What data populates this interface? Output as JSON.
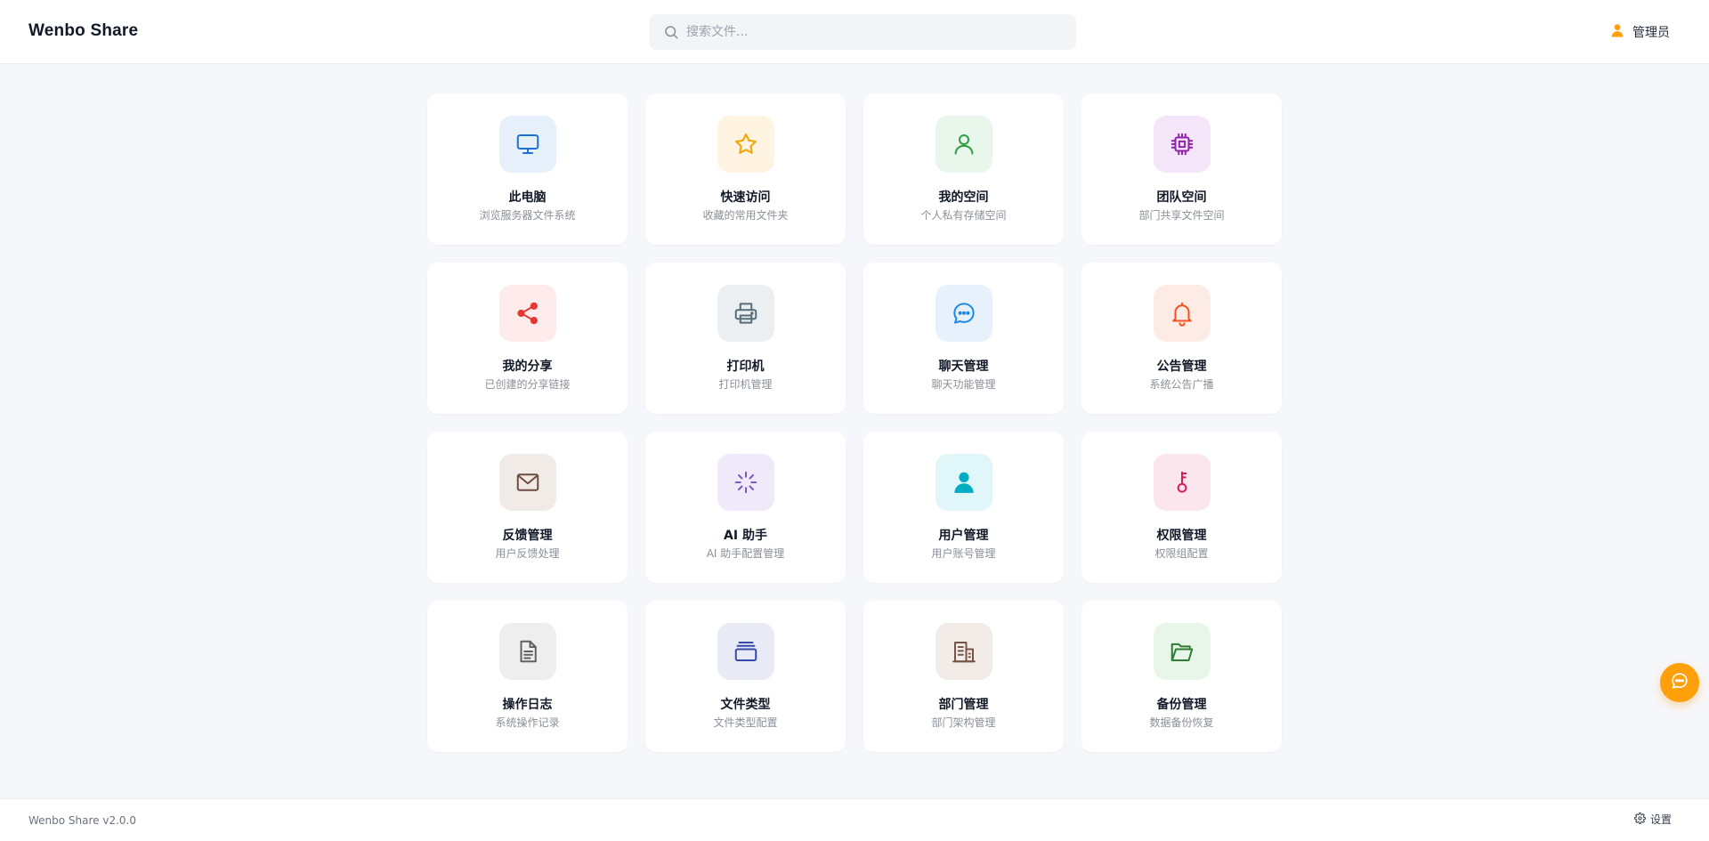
{
  "header": {
    "brand": "Wenbo Share",
    "search_placeholder": "搜索文件...",
    "user_label": "管理员",
    "accent_color": "#ff9f0a"
  },
  "cards": [
    {
      "name": "this-pc",
      "title": "此电脑",
      "desc": "浏览服务器文件系统",
      "icon": "monitor-icon",
      "color": "#1e6fd9",
      "bg": "#e6f0fb"
    },
    {
      "name": "quick-access",
      "title": "快速访问",
      "desc": "收藏的常用文件夹",
      "icon": "star-icon",
      "color": "#f5a300",
      "bg": "#fff4e2"
    },
    {
      "name": "my-space",
      "title": "我的空间",
      "desc": "个人私有存储空间",
      "icon": "user-outline-icon",
      "color": "#2e9e44",
      "bg": "#e9f6ec"
    },
    {
      "name": "team-space",
      "title": "团队空间",
      "desc": "部门共享文件空间",
      "icon": "chip-icon",
      "color": "#8e24aa",
      "bg": "#f4e6f8"
    },
    {
      "name": "my-share",
      "title": "我的分享",
      "desc": "已创建的分享链接",
      "icon": "share-icon",
      "color": "#e53935",
      "bg": "#fdeceb"
    },
    {
      "name": "printer",
      "title": "打印机",
      "desc": "打印机管理",
      "icon": "printer-icon",
      "color": "#546e7a",
      "bg": "#eceff1"
    },
    {
      "name": "chat-management",
      "title": "聊天管理",
      "desc": "聊天功能管理",
      "icon": "chat-icon",
      "color": "#1e88e5",
      "bg": "#e6f1fc"
    },
    {
      "name": "announcement-management",
      "title": "公告管理",
      "desc": "系统公告广播",
      "icon": "bell-icon",
      "color": "#f4511e",
      "bg": "#fdece5"
    },
    {
      "name": "feedback-management",
      "title": "反馈管理",
      "desc": "用户反馈处理",
      "icon": "mail-icon",
      "color": "#6d4c41",
      "bg": "#f1ebe8"
    },
    {
      "name": "ai-assistant",
      "title": "AI 助手",
      "desc": "AI 助手配置管理",
      "icon": "sparkle-icon",
      "color": "#7e57c2",
      "bg": "#efe9f9"
    },
    {
      "name": "user-management",
      "title": "用户管理",
      "desc": "用户账号管理",
      "icon": "user-solid-icon",
      "color": "#00acc1",
      "bg": "#e0f6f9"
    },
    {
      "name": "permission-management",
      "title": "权限管理",
      "desc": "权限组配置",
      "icon": "key-icon",
      "color": "#d81b60",
      "bg": "#fce6ee"
    },
    {
      "name": "operation-log",
      "title": "操作日志",
      "desc": "系统操作记录",
      "icon": "document-icon",
      "color": "#616161",
      "bg": "#eeeeee"
    },
    {
      "name": "file-types",
      "title": "文件类型",
      "desc": "文件类型配置",
      "icon": "layers-icon",
      "color": "#3949ab",
      "bg": "#e8eaf6"
    },
    {
      "name": "department-management",
      "title": "部门管理",
      "desc": "部门架构管理",
      "icon": "building-icon",
      "color": "#795548",
      "bg": "#f2ece9"
    },
    {
      "name": "backup-management",
      "title": "备份管理",
      "desc": "数据备份恢复",
      "icon": "folder-open-icon",
      "color": "#2e7d32",
      "bg": "#e8f5e9"
    }
  ],
  "footer": {
    "version": "Wenbo Share v2.0.0",
    "settings_label": "设置"
  }
}
